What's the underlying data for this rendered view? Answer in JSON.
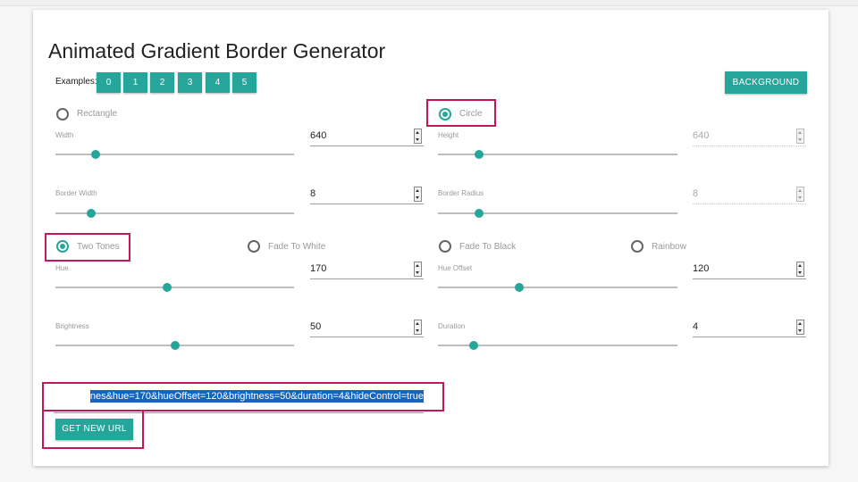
{
  "title": "Animated Gradient Border Generator",
  "examples": {
    "label": "Examples:",
    "buttons": [
      "0",
      "1",
      "2",
      "3",
      "4",
      "5"
    ]
  },
  "background_button": "BACKGROUND",
  "shape": {
    "options": [
      {
        "label": "Rectangle",
        "selected": false
      },
      {
        "label": "Circle",
        "selected": true
      }
    ]
  },
  "fields": {
    "width": {
      "label": "Width",
      "value": "640",
      "slider": 0.17
    },
    "height": {
      "label": "Height",
      "value": "640",
      "slider": 0.17
    },
    "border_width": {
      "label": "Border Width",
      "value": "8",
      "slider": 0.15
    },
    "border_radius": {
      "label": "Border Radius",
      "value": "8",
      "slider": 0.17
    },
    "hue": {
      "label": "Hue",
      "value": "170",
      "slider": 0.47
    },
    "hue_offset": {
      "label": "Hue Offset",
      "value": "120",
      "slider": 0.34
    },
    "brightness": {
      "label": "Brightness",
      "value": "50",
      "slider": 0.5
    },
    "duration": {
      "label": "Duration",
      "value": "4",
      "slider": 0.15
    }
  },
  "color_mode": {
    "options": [
      {
        "label": "Two Tones",
        "selected": true
      },
      {
        "label": "Fade To White",
        "selected": false
      },
      {
        "label": "Fade To Black",
        "selected": false
      },
      {
        "label": "Rainbow",
        "selected": false
      }
    ]
  },
  "url_field": {
    "value": "nes&hue=170&hueOffset=120&brightness=50&duration=4&hideControl=true"
  },
  "get_url_button": "GET NEW URL",
  "colors": {
    "accent": "#26a69a",
    "highlight": "#c2185b",
    "selection": "#1565c0"
  }
}
